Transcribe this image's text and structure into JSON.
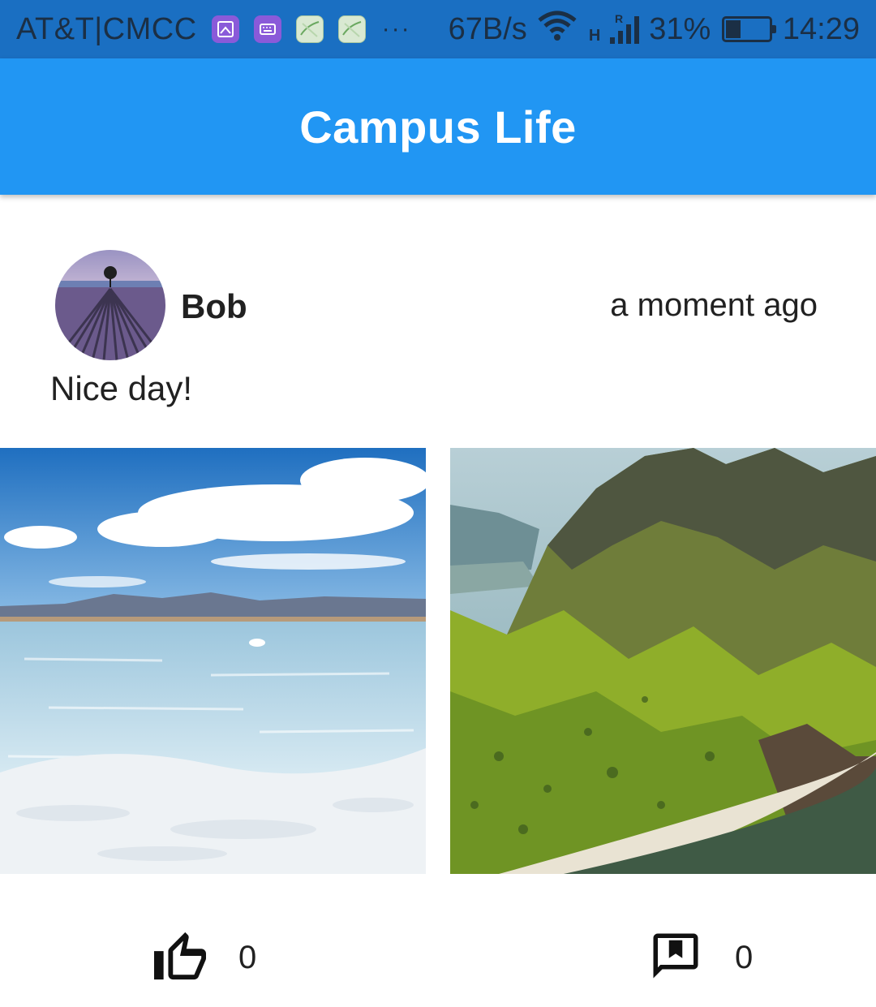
{
  "status_bar": {
    "carrier": "AT&T|CMCC",
    "network_speed": "67B/s",
    "network_type": "H",
    "roaming": "R",
    "battery_percent": "31%",
    "battery_level": 0.31,
    "time": "14:29",
    "more_indicator": "···"
  },
  "app_bar": {
    "title": "Campus Life"
  },
  "post": {
    "author": "Bob",
    "timestamp": "a moment ago",
    "text": "Nice day!",
    "photos": [
      "salt-lake-photo",
      "green-mountain-coast-photo"
    ],
    "like_count": "0",
    "comment_count": "0"
  },
  "colors": {
    "status_bar": "#1a6fc2",
    "app_bar": "#2196f3",
    "text": "#212121"
  }
}
